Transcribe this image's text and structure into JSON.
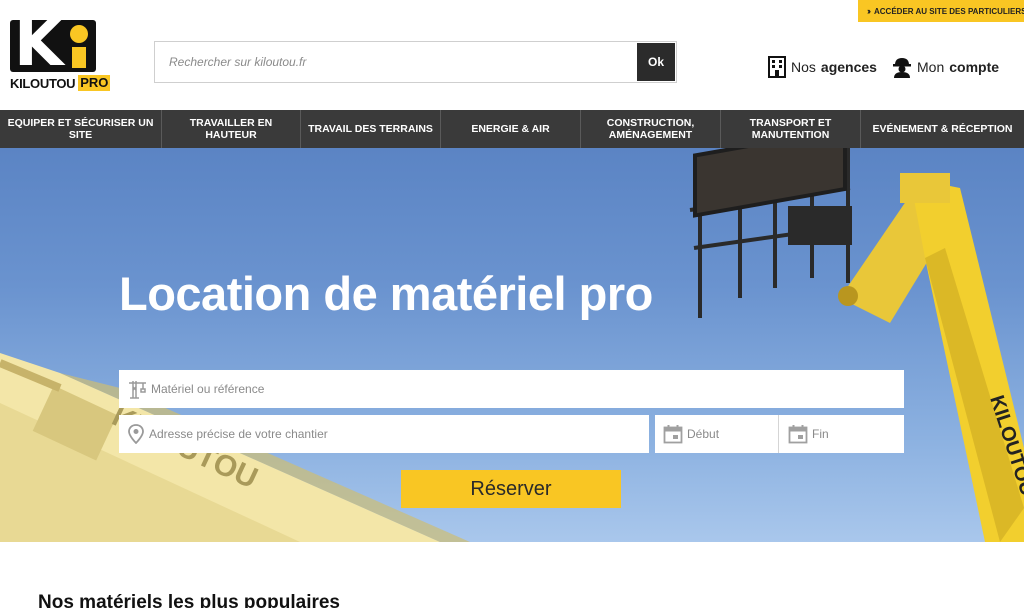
{
  "top_link": {
    "label": "ACCÉDER AU SITE DES PARTICULIERS",
    "chevron": "››"
  },
  "logo": {
    "name": "KILOUTOU",
    "suffix": "PRO",
    "brand_color": "#f9c623"
  },
  "search": {
    "placeholder": "Rechercher sur kiloutou.fr",
    "value": "",
    "button": "Ok"
  },
  "header_links": {
    "agences": {
      "prefix": "Nos",
      "bold": "agences",
      "icon": "building-icon"
    },
    "compte": {
      "prefix": "Mon",
      "bold": "compte",
      "icon": "worker-helmet-icon"
    }
  },
  "nav": {
    "items": [
      {
        "label": "EQUIPER ET SÉCURISER UN SITE"
      },
      {
        "label": "TRAVAILLER EN HAUTEUR"
      },
      {
        "label": "TRAVAIL DES TERRAINS"
      },
      {
        "label": "ENERGIE & AIR"
      },
      {
        "label": "CONSTRUCTION, AMÉNAGEMENT"
      },
      {
        "label": "TRANSPORT ET MANUTENTION"
      },
      {
        "label": "EVÉNEMENT & RÉCEPTION"
      }
    ]
  },
  "hero": {
    "title": "Location de matériel pro",
    "material_placeholder": "Matériel ou référence",
    "address_placeholder": "Adresse précise de votre chantier",
    "start_placeholder": "Début",
    "end_placeholder": "Fin",
    "reserve_button": "Réserver",
    "boom_brand_left": "KILOUTOU",
    "boom_brand_right": "KILOUTOU"
  },
  "section": {
    "popular_title": "Nos matériels les plus populaires"
  },
  "colors": {
    "accent": "#f9c623",
    "nav_bg": "#3a3a3a",
    "button_dark": "#2b2b2b"
  }
}
